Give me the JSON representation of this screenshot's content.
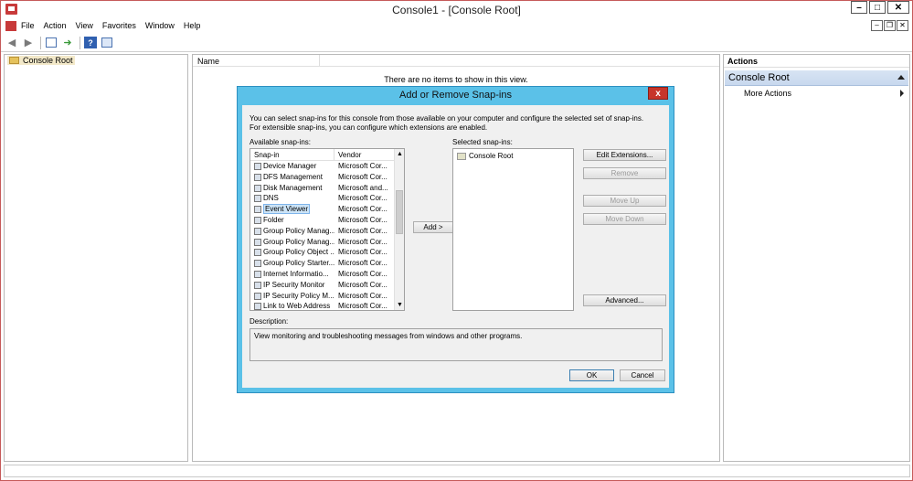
{
  "window": {
    "title": "Console1 - [Console Root]"
  },
  "menubar": {
    "items": [
      "File",
      "Action",
      "View",
      "Favorites",
      "Window",
      "Help"
    ]
  },
  "tree": {
    "root_label": "Console Root"
  },
  "list": {
    "column_name": "Name",
    "empty_message": "There are no items to show in this view."
  },
  "actions": {
    "title": "Actions",
    "section": "Console Root",
    "more_actions": "More Actions"
  },
  "dialog": {
    "title": "Add or Remove Snap-ins",
    "close_label": "x",
    "intro": "You can select snap-ins for this console from those available on your computer and configure the selected set of snap-ins. For extensible snap-ins, you can configure which extensions are enabled.",
    "available_label": "Available snap-ins:",
    "selected_label": "Selected snap-ins:",
    "col_snapin": "Snap-in",
    "col_vendor": "Vendor",
    "snapins": [
      {
        "name": "Device Manager",
        "vendor": "Microsoft Cor..."
      },
      {
        "name": "DFS Management",
        "vendor": "Microsoft Cor..."
      },
      {
        "name": "Disk Management",
        "vendor": "Microsoft and..."
      },
      {
        "name": "DNS",
        "vendor": "Microsoft Cor..."
      },
      {
        "name": "Event Viewer",
        "vendor": "Microsoft Cor..."
      },
      {
        "name": "Folder",
        "vendor": "Microsoft Cor..."
      },
      {
        "name": "Group Policy Manag...",
        "vendor": "Microsoft Cor..."
      },
      {
        "name": "Group Policy Manag...",
        "vendor": "Microsoft Cor..."
      },
      {
        "name": "Group Policy Object ...",
        "vendor": "Microsoft Cor..."
      },
      {
        "name": "Group Policy Starter...",
        "vendor": "Microsoft Cor..."
      },
      {
        "name": "Internet Informatio...",
        "vendor": "Microsoft Cor..."
      },
      {
        "name": "IP Security Monitor",
        "vendor": "Microsoft Cor..."
      },
      {
        "name": "IP Security Policy M...",
        "vendor": "Microsoft Cor..."
      },
      {
        "name": "Link to Web Address",
        "vendor": "Microsoft Cor..."
      }
    ],
    "selected_index": 4,
    "add_button": "Add >",
    "selected_items": [
      "Console Root"
    ],
    "edit_extensions": "Edit Extensions...",
    "remove": "Remove",
    "move_up": "Move Up",
    "move_down": "Move Down",
    "advanced": "Advanced...",
    "description_label": "Description:",
    "description": "View monitoring and troubleshooting messages from windows and other programs.",
    "ok": "OK",
    "cancel": "Cancel"
  }
}
